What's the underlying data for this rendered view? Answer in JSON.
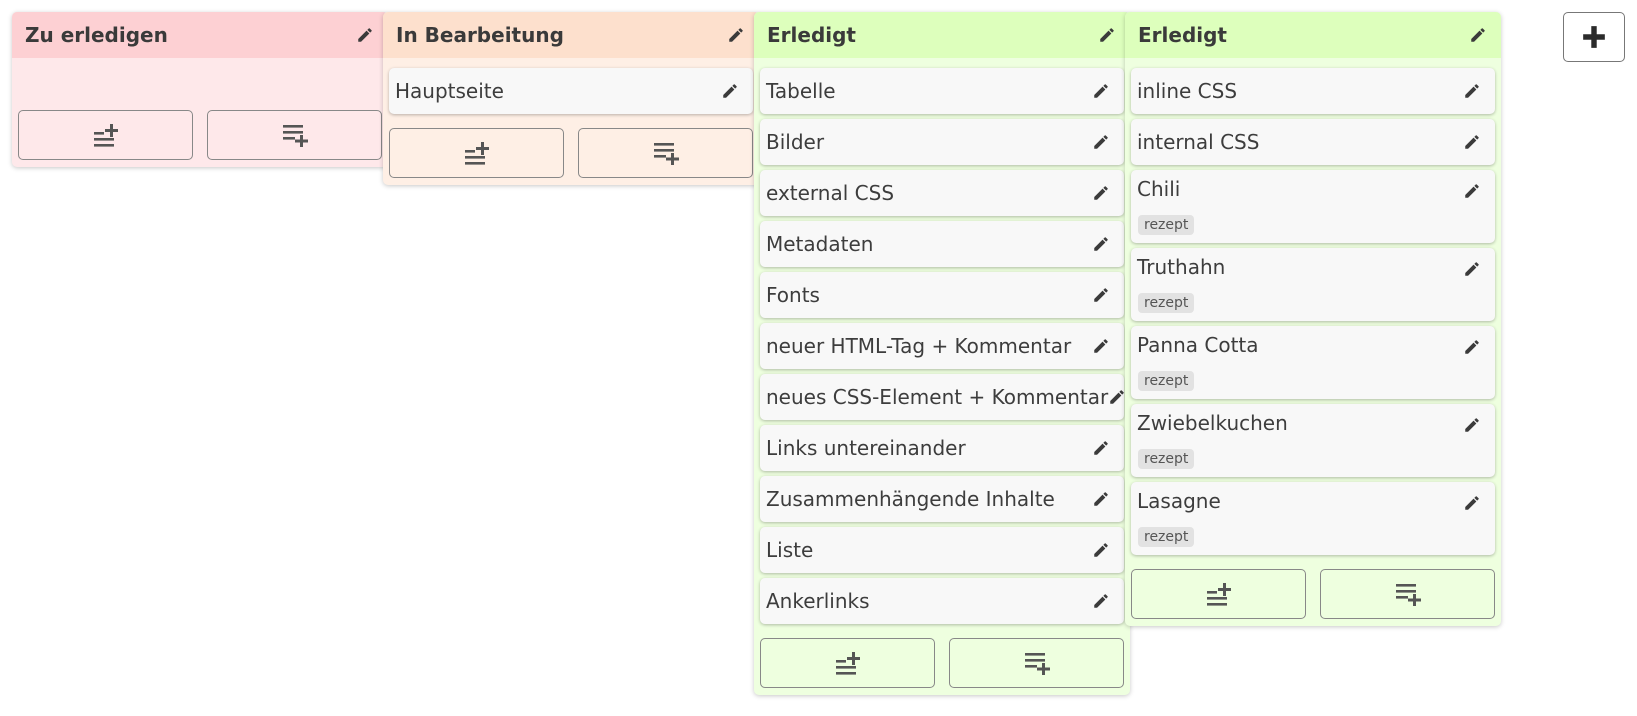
{
  "columns": [
    {
      "title": "Zu erledigen",
      "header_color": "#fdd0d3",
      "body_color": "#fee8ea",
      "cards": []
    },
    {
      "title": "In Bearbeitung",
      "header_color": "#fde0cd",
      "body_color": "#feefe5",
      "cards": [
        {
          "title": "Hauptseite"
        }
      ]
    },
    {
      "title": "Erledigt",
      "header_color": "#ddffbc",
      "body_color": "#eeffdf",
      "cards": [
        {
          "title": "Tabelle"
        },
        {
          "title": "Bilder"
        },
        {
          "title": "external CSS"
        },
        {
          "title": "Metadaten"
        },
        {
          "title": "Fonts"
        },
        {
          "title": "neuer HTML-Tag + Kommentar"
        },
        {
          "title": "neues CSS-Element + Kommentar"
        },
        {
          "title": "Links untereinander"
        },
        {
          "title": "Zusammenhängende Inhalte"
        },
        {
          "title": "Liste"
        },
        {
          "title": "Ankerlinks"
        }
      ]
    },
    {
      "title": "Erledigt",
      "header_color": "#ddffbc",
      "body_color": "#eeffdf",
      "cards": [
        {
          "title": "inline CSS"
        },
        {
          "title": "internal CSS"
        },
        {
          "title": "Chili",
          "tag": "rezept"
        },
        {
          "title": "Truthahn",
          "tag": "rezept"
        },
        {
          "title": "Panna Cotta",
          "tag": "rezept"
        },
        {
          "title": "Zwiebelkuchen",
          "tag": "rezept"
        },
        {
          "title": "Lasagne",
          "tag": "rezept"
        }
      ]
    }
  ],
  "icons": {
    "edit": "pencil-icon",
    "add_card_top": "playlist-add-top-icon",
    "add_card_bottom": "playlist-add-icon",
    "add_column": "plus-icon"
  }
}
